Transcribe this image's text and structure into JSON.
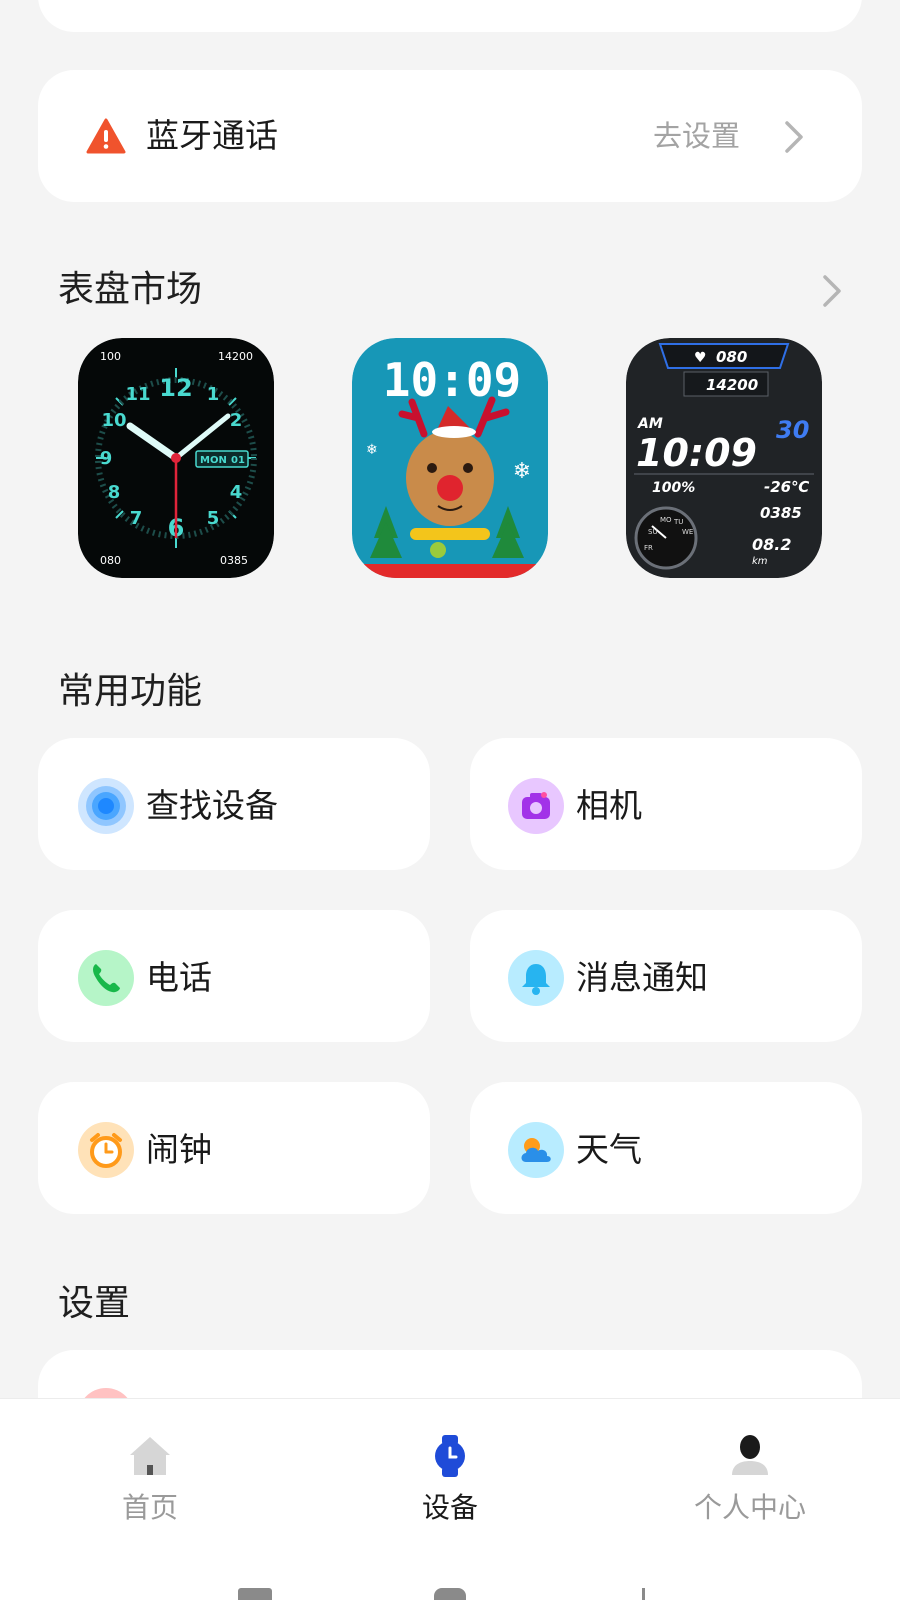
{
  "bluetooth_call": {
    "title": "蓝牙通话",
    "action": "去设置",
    "warning_icon": "warning-triangle-icon",
    "warning_color": "#f0532d"
  },
  "watch_face_market": {
    "title": "表盘市场",
    "faces": [
      {
        "name": "analog-teal",
        "heart": "100",
        "steps": "14200",
        "hours": [
          "12",
          "1",
          "2",
          "3",
          "4",
          "5",
          "6",
          "7",
          "8",
          "9",
          "10",
          "11"
        ],
        "day": "MON",
        "date": "01",
        "bpm": "080",
        "calories": "0385"
      },
      {
        "name": "christmas-reindeer",
        "time": "10:09"
      },
      {
        "name": "digital-sport",
        "heart": "080",
        "steps": "14200",
        "ampm": "AM",
        "time": "10:09",
        "date": "30",
        "battery": "100%",
        "temperature": "-26℃",
        "calories": "0385",
        "distance": "08.2",
        "distance_unit": "km",
        "weekdays": [
          "SU",
          "MO",
          "TU",
          "WE",
          "FR"
        ]
      }
    ]
  },
  "common_functions": {
    "title": "常用功能",
    "items": [
      {
        "label": "查找设备",
        "icon": "find-device-icon",
        "color": "#cfe6ff"
      },
      {
        "label": "相机",
        "icon": "camera-icon",
        "color": "#e8c7ff"
      },
      {
        "label": "电话",
        "icon": "phone-icon",
        "color": "#b6f5c8"
      },
      {
        "label": "消息通知",
        "icon": "bell-icon",
        "color": "#b8ecff"
      },
      {
        "label": "闹钟",
        "icon": "alarm-clock-icon",
        "color": "#ffe2b8"
      },
      {
        "label": "天气",
        "icon": "weather-icon",
        "color": "#b8ecff"
      }
    ]
  },
  "settings": {
    "title": "设置"
  },
  "bottom_nav": {
    "items": [
      {
        "label": "首页",
        "icon": "home-icon",
        "active": false
      },
      {
        "label": "设备",
        "icon": "watch-icon",
        "active": true
      },
      {
        "label": "个人中心",
        "icon": "person-icon",
        "active": false
      }
    ],
    "active_color": "#1f4bd8"
  }
}
